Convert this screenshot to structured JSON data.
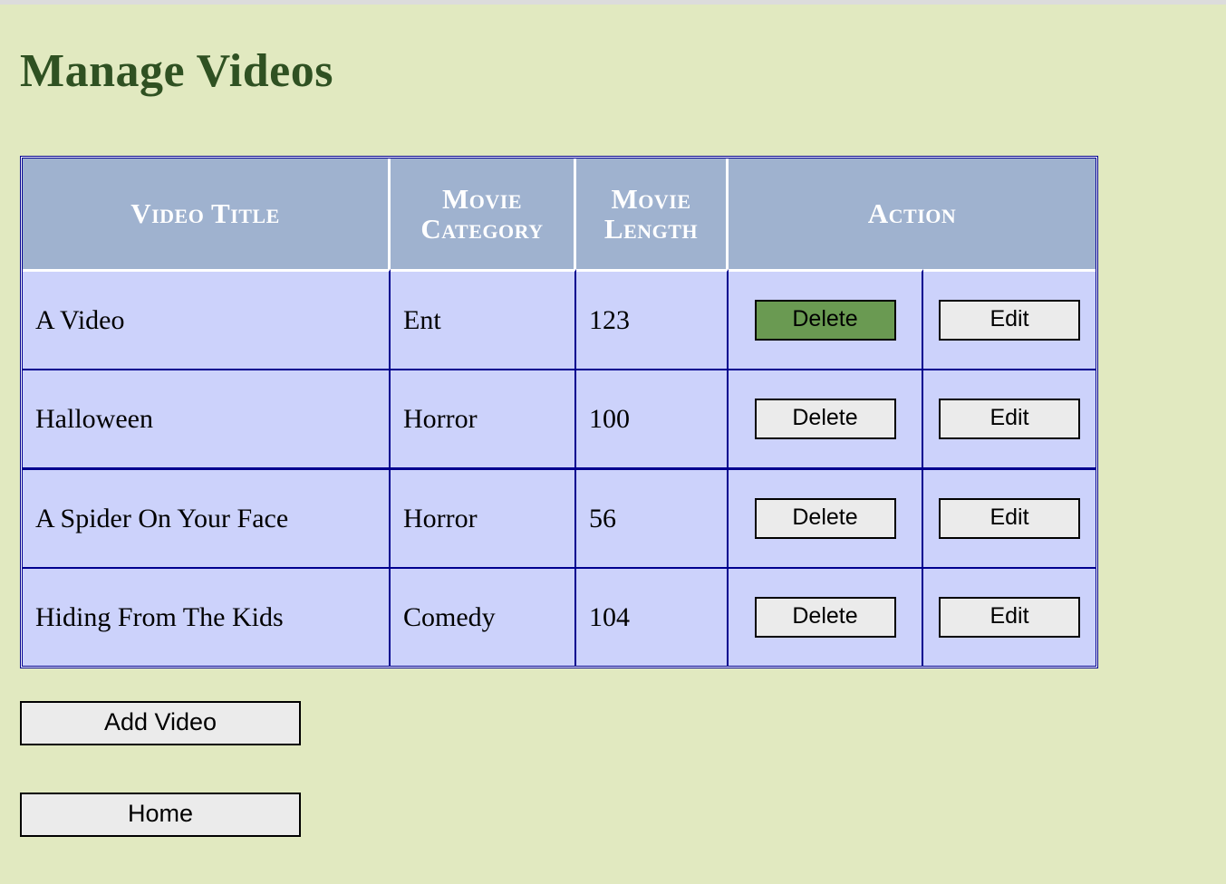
{
  "page": {
    "title": "Manage Videos",
    "background_color": "#e1e9c0",
    "title_color": "#2f5122"
  },
  "table": {
    "header_bg": "#9fb2cf",
    "cell_bg": "#ccd2fb",
    "border_color": "#00008f",
    "columns": [
      "Video Title",
      "Movie Category",
      "Movie Length",
      "Action"
    ],
    "rows": [
      {
        "title": "A Video",
        "category": "Ent",
        "length": "123",
        "delete_label": "Delete",
        "edit_label": "Edit",
        "delete_highlighted": true
      },
      {
        "title": "Halloween",
        "category": "Horror",
        "length": "100",
        "delete_label": "Delete",
        "edit_label": "Edit",
        "delete_highlighted": false
      },
      {
        "title": "A Spider On Your Face",
        "category": "Horror",
        "length": "56",
        "delete_label": "Delete",
        "edit_label": "Edit",
        "delete_highlighted": false
      },
      {
        "title": "Hiding From The Kids",
        "category": "Comedy",
        "length": "104",
        "delete_label": "Delete",
        "edit_label": "Edit",
        "delete_highlighted": false
      }
    ],
    "highlight_color": "#6a9a52",
    "button_bg": "#ebebeb"
  },
  "bottom_actions": {
    "add_video_label": "Add Video",
    "home_label": "Home"
  }
}
